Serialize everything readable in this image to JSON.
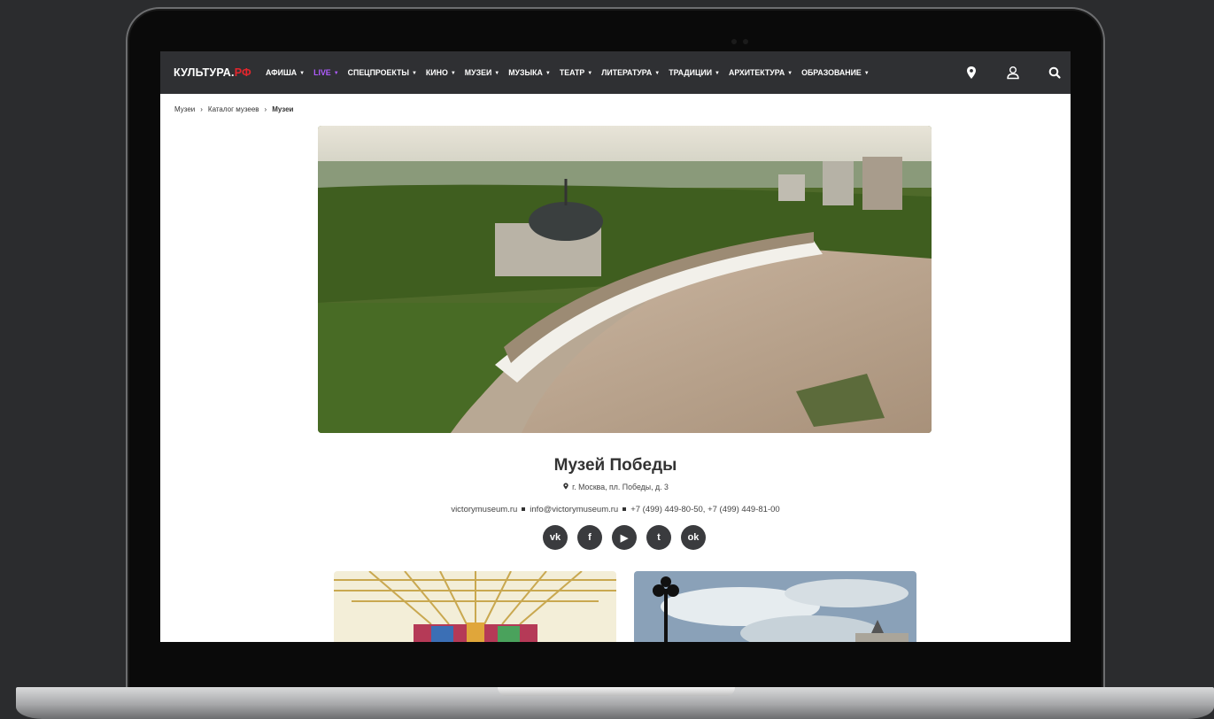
{
  "header": {
    "logo_main": "КУЛЬТУРА.",
    "logo_accent": "РФ",
    "menu": [
      {
        "label": "АФИША",
        "caret": "▼"
      },
      {
        "label": "LIVE",
        "caret": "▼"
      },
      {
        "label": "СПЕЦПРОЕКТЫ",
        "caret": "▼"
      },
      {
        "label": "КИНО",
        "caret": "▼"
      },
      {
        "label": "МУЗЕИ",
        "caret": "▼"
      },
      {
        "label": "МУЗЫКА",
        "caret": "▼"
      },
      {
        "label": "ТЕАТР",
        "caret": "▼"
      },
      {
        "label": "ЛИТЕРАТУРА",
        "caret": "▼"
      },
      {
        "label": "ТРАДИЦИИ",
        "caret": "▼"
      },
      {
        "label": "АРХИТЕКТУРА",
        "caret": "▼"
      },
      {
        "label": "ОБРАЗОВАНИЕ",
        "caret": "▼"
      }
    ],
    "icons": [
      "location-pin-icon",
      "user-icon",
      "search-icon"
    ]
  },
  "breadcrumb": {
    "items": [
      "Музеи",
      "Каталог музеев",
      "Музеи"
    ],
    "separator": "›"
  },
  "museum": {
    "title": "Музей Победы",
    "address": "г. Москва, пл. Победы, д. 3",
    "website": "victorymuseum.ru",
    "email": "info@victorymuseum.ru",
    "phones": "+7 (499) 449-80-50,  +7 (499) 449-81-00"
  },
  "socials": [
    {
      "icon": "vk-icon",
      "glyph": "vk"
    },
    {
      "icon": "facebook-icon",
      "glyph": "f"
    },
    {
      "icon": "youtube-icon",
      "glyph": "▶"
    },
    {
      "icon": "twitter-icon",
      "glyph": "t"
    },
    {
      "icon": "odnoklassniki-icon",
      "glyph": "ok"
    }
  ],
  "colors": {
    "nav_bg": "#2f3033",
    "logo_accent": "#e3262d",
    "live_accent": "#b05cff",
    "social_bg": "#3a3b3e"
  }
}
